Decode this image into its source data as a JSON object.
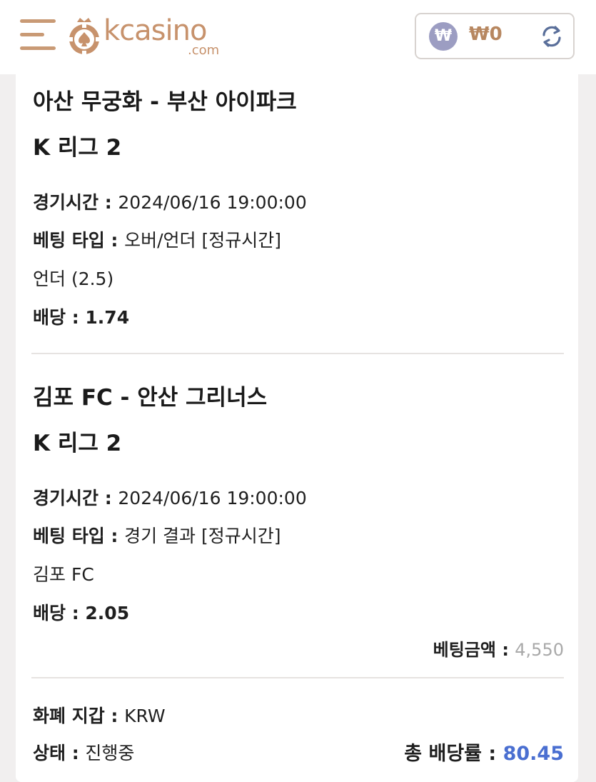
{
  "header": {
    "logo_word": "kcasino",
    "logo_sub": ".com",
    "wallet_symbol": "₩",
    "wallet_amount": "₩0"
  },
  "bets": [
    {
      "title": "아산 무궁화 - 부산 아이파크",
      "league": "K 리그 2",
      "time_label": "경기시간 : ",
      "time_value": "2024/06/16 19:00:00",
      "type_label": "베팅 타입 : ",
      "type_value": "오버/언더 [정규시간]",
      "selection": "언더 (2.5)",
      "odds_label": "배당 : ",
      "odds_value": "1.74"
    },
    {
      "title": "김포 FC - 안산 그리너스",
      "league": "K 리그 2",
      "time_label": "경기시간 : ",
      "time_value": "2024/06/16 19:00:00",
      "type_label": "베팅 타입 : ",
      "type_value": "경기 결과 [정규시간]",
      "selection": "김포 FC",
      "odds_label": "배당 : ",
      "odds_value": "2.05"
    }
  ],
  "summary": {
    "bet_amount_label": "베팅금액 : ",
    "bet_amount_value": "4,550",
    "currency_label": "화폐 지갑 : ",
    "currency_value": "KRW",
    "status_label": "상태 : ",
    "status_value": "진행중",
    "total_odds_label": "총 배당률 : ",
    "total_odds_value": "80.45"
  },
  "colors": {
    "brand": "#c7926c",
    "total_odds": "#4a6fd1",
    "won_badge": "#9c9dc2"
  },
  "icons": [
    "menu-icon",
    "casino-chip-logo-icon",
    "won-icon",
    "refresh-icon"
  ]
}
